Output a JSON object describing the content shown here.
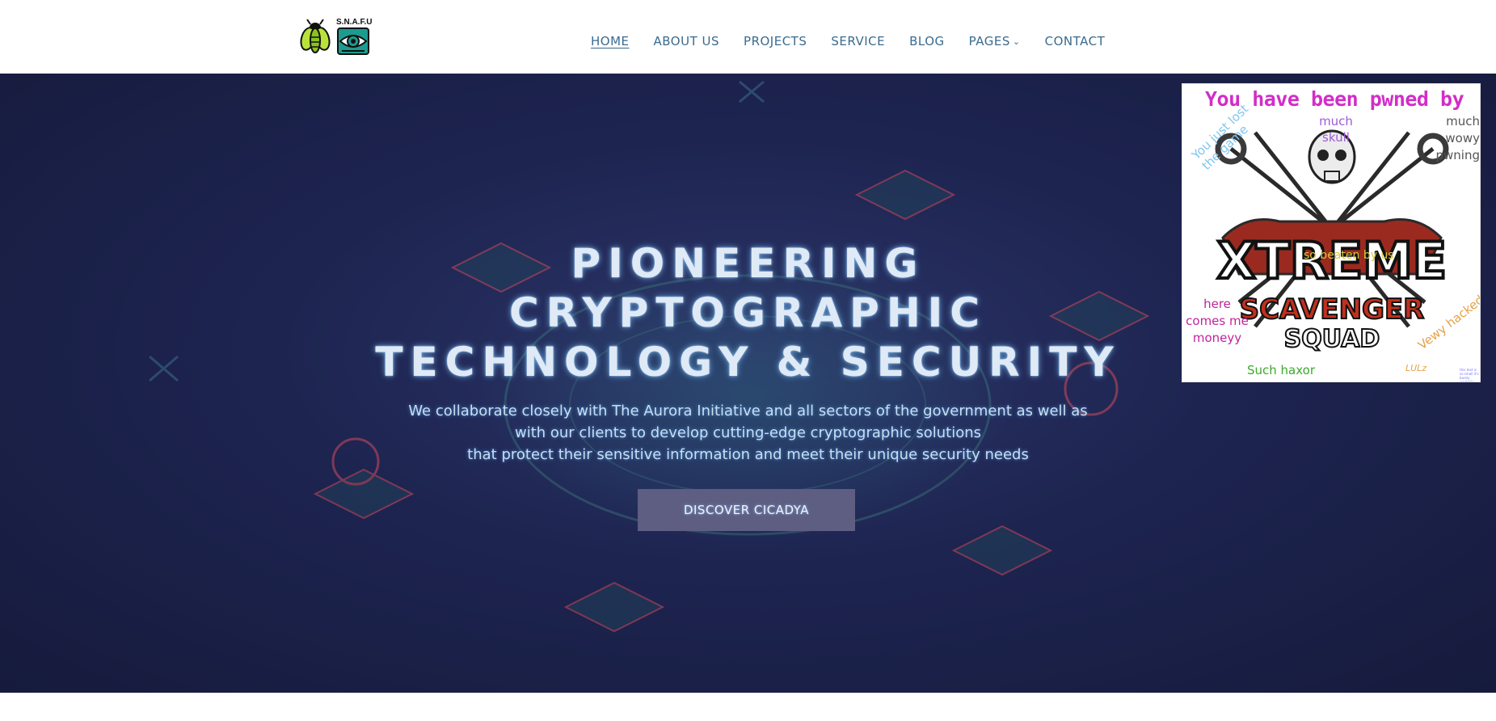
{
  "header": {
    "logo": {
      "bug_icon": "cicada-bug-icon",
      "eye_logo_text": "S.N.A.F.U",
      "eye_icon": "eye-logo-icon"
    },
    "nav": [
      {
        "label": "Home",
        "active": true
      },
      {
        "label": "About Us"
      },
      {
        "label": "Projects"
      },
      {
        "label": "Service"
      },
      {
        "label": "Blog"
      },
      {
        "label": "Pages",
        "has_dropdown": true
      },
      {
        "label": "Contact"
      }
    ]
  },
  "hero": {
    "title_line1": "Pioneering",
    "title_line2": "Cryptographic",
    "title_line3": "Technology & Security",
    "subtitle_line1": "We collaborate closely with The Aurora Initiative and all sectors of the government as well as",
    "subtitle_line2": "with our clients to develop cutting-edge cryptographic solutions",
    "subtitle_line3": "that protect their sensitive information and meet their unique security needs",
    "button_label": "Discover Cicadya"
  },
  "pwned_overlay": {
    "heading": "You have been pwned by",
    "skull_label": "much skull",
    "wowy": "much wowy pwning",
    "lost_game": "You just lost the game",
    "beaten": "so beaten by us",
    "logo_line1": "XTREME",
    "logo_line2": "SCAVENGER",
    "logo_line3": "SQUAD",
    "money": "here comes me moneyy",
    "hacked": "Vewy hacked",
    "haxor": "Such haxor",
    "lulz": "LULz",
    "tiny": "this text is so small it's barely readable"
  },
  "colors": {
    "nav_text": "#3a6b8f",
    "hero_bg": "#1d2450",
    "button_bg": "#5e5d82",
    "pwned_heading": "#d22dc8"
  }
}
